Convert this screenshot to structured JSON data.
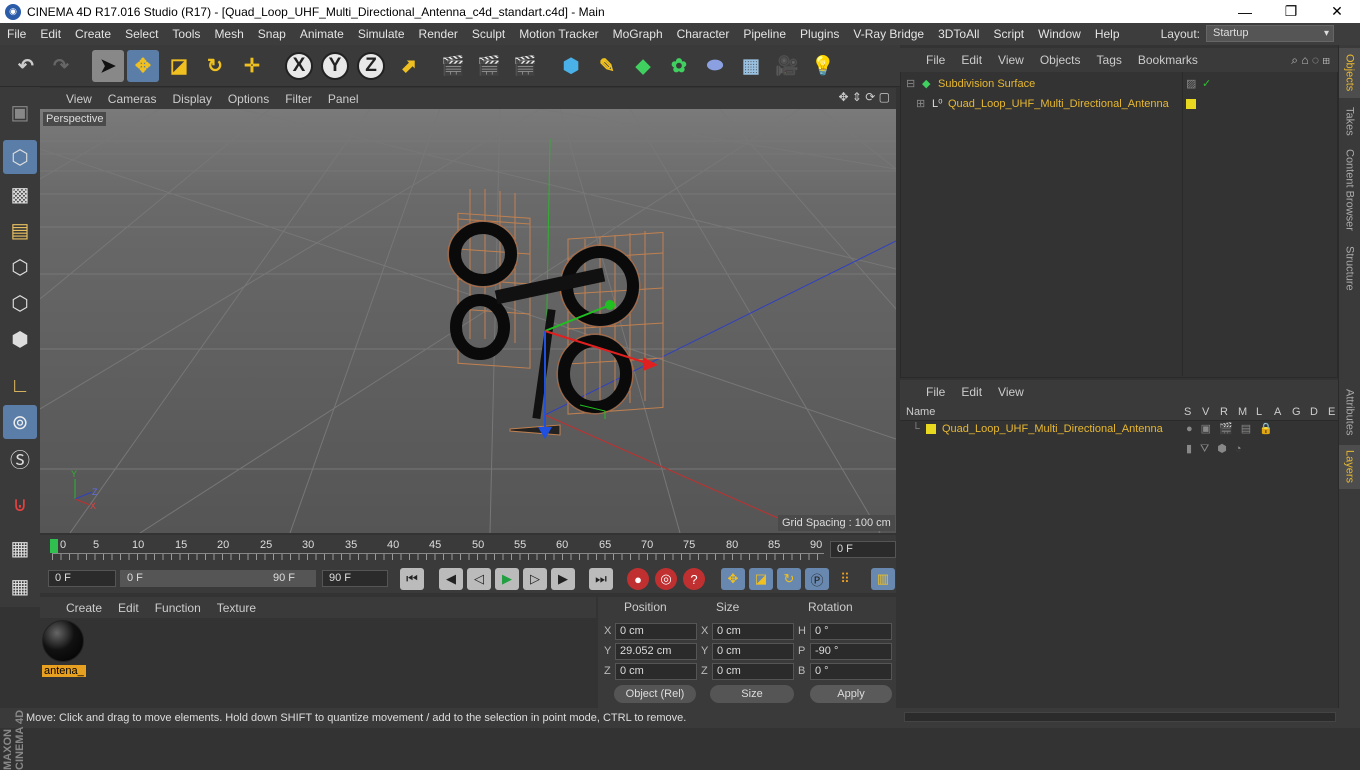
{
  "title": "CINEMA 4D R17.016 Studio (R17) - [Quad_Loop_UHF_Multi_Directional_Antenna_c4d_standart.c4d] - Main",
  "menu": [
    "File",
    "Edit",
    "Create",
    "Select",
    "Tools",
    "Mesh",
    "Snap",
    "Animate",
    "Simulate",
    "Render",
    "Sculpt",
    "Motion Tracker",
    "MoGraph",
    "Character",
    "Pipeline",
    "Plugins",
    "V-Ray Bridge",
    "3DToAll",
    "Script",
    "Window",
    "Help"
  ],
  "layout": {
    "label": "Layout:",
    "value": "Startup"
  },
  "viewport": {
    "menu": [
      "View",
      "Cameras",
      "Display",
      "Options",
      "Filter",
      "Panel"
    ],
    "label": "Perspective",
    "grid_spacing": "Grid Spacing : 100 cm"
  },
  "timeline": {
    "ticks": [
      "0",
      "5",
      "10",
      "15",
      "20",
      "25",
      "30",
      "35",
      "40",
      "45",
      "50",
      "55",
      "60",
      "65",
      "70",
      "75",
      "80",
      "85",
      "90"
    ],
    "end_field": "0 F",
    "current_frame": "0 F",
    "range_start": "0 F",
    "range_end": "90 F",
    "max_frame": "90 F"
  },
  "materials": {
    "menu": [
      "Create",
      "Edit",
      "Function",
      "Texture"
    ],
    "items": [
      {
        "name": "antena_"
      }
    ]
  },
  "coordinates": {
    "headers": {
      "position": "Position",
      "size": "Size",
      "rotation": "Rotation"
    },
    "position": {
      "x": "0 cm",
      "y": "29.052 cm",
      "z": "0 cm"
    },
    "size": {
      "x": "0 cm",
      "y": "0 cm",
      "z": "0 cm"
    },
    "rotation": {
      "h": "0 °",
      "p": "-90 °",
      "b": "0 °"
    },
    "axis_labels": {
      "x": "X",
      "y": "Y",
      "z": "Z",
      "h": "H",
      "p": "P",
      "b": "B"
    },
    "mode_select": "Object (Rel)",
    "size_select": "Size",
    "apply": "Apply"
  },
  "objects": {
    "menu": [
      "File",
      "Edit",
      "View",
      "Objects",
      "Tags",
      "Bookmarks"
    ],
    "tree": [
      {
        "name": "Subdivision Surface"
      },
      {
        "name": "Quad_Loop_UHF_Multi_Directional_Antenna"
      }
    ]
  },
  "layers": {
    "menu": [
      "File",
      "Edit",
      "View"
    ],
    "columns": {
      "name": "Name",
      "flags": [
        "S",
        "V",
        "R",
        "M",
        "L",
        "A",
        "G",
        "D",
        "E"
      ]
    },
    "rows": [
      {
        "name": "Quad_Loop_UHF_Multi_Directional_Antenna"
      }
    ]
  },
  "right_tabs": [
    "Objects",
    "Takes",
    "Content Browser",
    "Structure",
    "Attributes",
    "Layers"
  ],
  "status": "Move: Click and drag to move elements. Hold down SHIFT to quantize movement / add to the selection in point mode, CTRL to remove.",
  "brand": {
    "line1": "MAXON",
    "line2": "CINEMA 4D"
  },
  "colors": {
    "accent": "#5b7ea8",
    "highlight": "#e8b830",
    "layer": "#e8d820"
  }
}
